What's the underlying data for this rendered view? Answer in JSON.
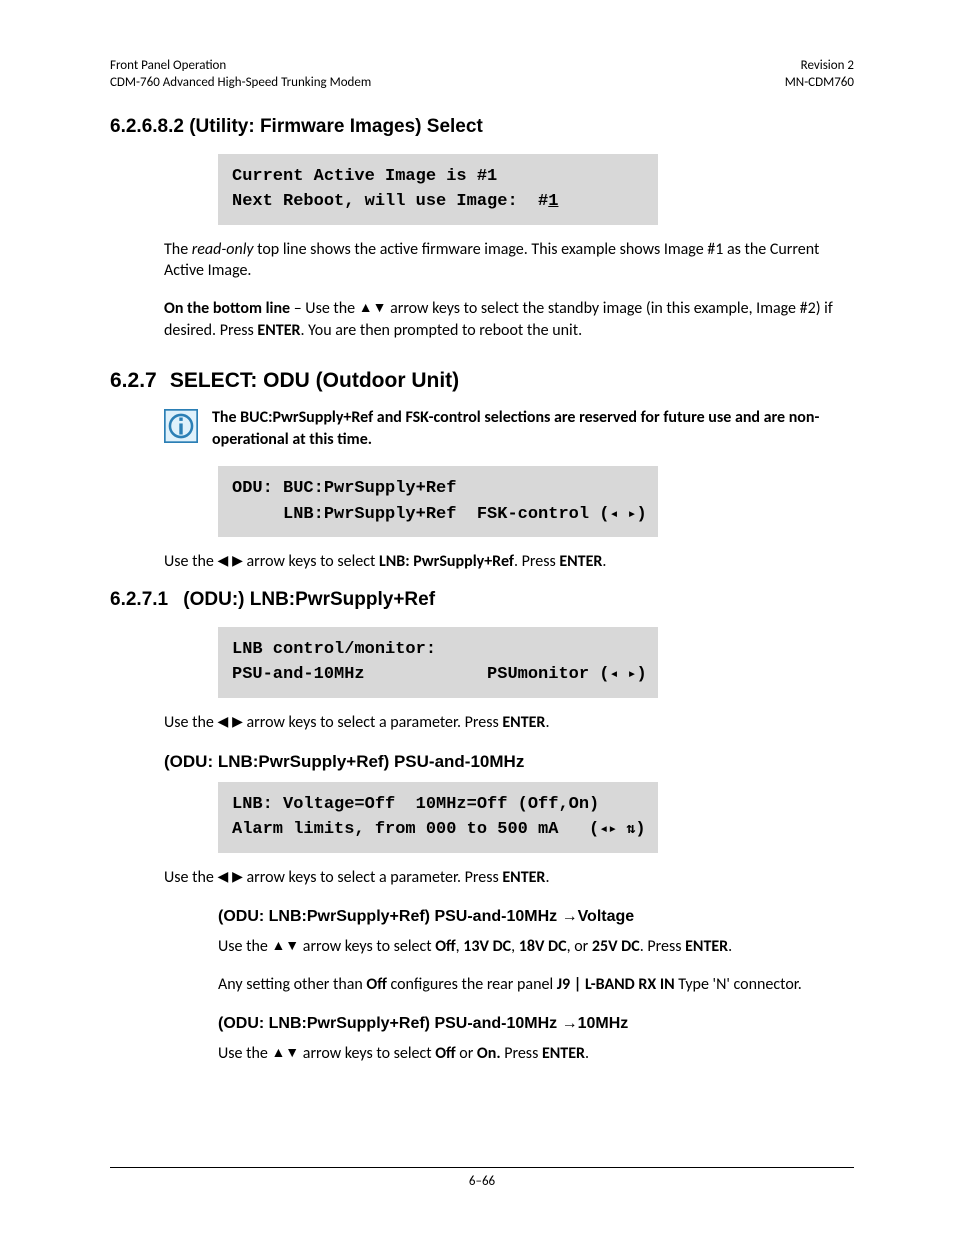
{
  "header": {
    "left1": "Front Panel Operation",
    "left2": "CDM-760 Advanced High-Speed Trunking Modem",
    "right1": "Revision 2",
    "right2": "MN-CDM760"
  },
  "s1": {
    "num": "6.2.6.8.2",
    "title": "(Utility: Firmware Images) Select",
    "lcd1": "Current Active Image is #1",
    "lcd2a": "Next Reboot, will use Image:  #",
    "lcd2b": "1",
    "p1a": "The ",
    "p1b": "read-only",
    "p1c": " top line shows the active firmware image. This example shows Image #1 as the Current Active Image.",
    "p2a": "On the bottom line",
    "p2b": " – Use the ",
    "p2c": " arrow keys to select the standby image (in this example, Image #2) if desired. Press ",
    "p2d": "ENTER",
    "p2e": ". You are then prompted to reboot the unit."
  },
  "s2": {
    "num": "6.2.7",
    "title": "SELECT: ODU (Outdoor Unit)",
    "note": "The BUC:PwrSupply+Ref and FSK-control selections are reserved for future use and are non-operational at this time.",
    "lcd1": "ODU: BUC:PwrSupply+Ref",
    "lcd2": "     LNB:PwrSupply+Ref  FSK-control (",
    "lcd2end": ")",
    "p1a": "Use the ",
    "p1b": " arrow keys to select ",
    "p1c": "LNB: PwrSupply+Ref",
    "p1d": ". Press ",
    "p1e": "ENTER",
    "p1f": "."
  },
  "s3": {
    "num": "6.2.7.1",
    "title": "(ODU:) LNB:PwrSupply+Ref",
    "lcd1": "LNB control/monitor:",
    "lcd2a": "PSU-and-10MHz            PSUmonitor (",
    "lcd2end": ")",
    "p1a": "Use the ",
    "p1b": " arrow keys to select a parameter. Press ",
    "p1c": "ENTER",
    "p1d": "."
  },
  "s4": {
    "title": "(ODU: LNB:PwrSupply+Ref) PSU-and-10MHz",
    "lcd1": "LNB: Voltage=Off  10MHz=Off (Off,On)",
    "lcd2a": "Alarm limits, from 000 to 500 mA   (",
    "lcd2end": ")",
    "p1a": "Use the ",
    "p1b": " arrow keys to select a parameter. Press ",
    "p1c": "ENTER",
    "p1d": "."
  },
  "s5": {
    "title": "(ODU: LNB:PwrSupply+Ref) PSU-and-10MHz →Voltage",
    "p1a": "Use the ",
    "p1b": " arrow keys to select ",
    "p1c": "Off",
    "p1d": ", ",
    "p1e": "13V DC",
    "p1f": ", ",
    "p1g": "18V DC",
    "p1h": ", or ",
    "p1i": "25V DC",
    "p1j": ". Press ",
    "p1k": "ENTER",
    "p1l": ".",
    "p2a": "Any setting other than ",
    "p2b": "Off",
    "p2c": " configures the rear panel ",
    "p2d": "J9 | L-BAND RX IN",
    "p2e": " Type 'N' connector."
  },
  "s6": {
    "title": "(ODU: LNB:PwrSupply+Ref) PSU-and-10MHz →10MHz",
    "p1a": "Use the ",
    "p1b": " arrow keys to select ",
    "p1c": "Off",
    "p1d": " or ",
    "p1e": "On.",
    "p1f": " Press ",
    "p1g": "ENTER",
    "p1h": "."
  },
  "footer": "6–66",
  "glyph": {
    "updown": "▲▼",
    "leftright": "◀ ▶",
    "lr_small": "◂ ▸",
    "lrud_small": "◂▸ ⇅"
  }
}
